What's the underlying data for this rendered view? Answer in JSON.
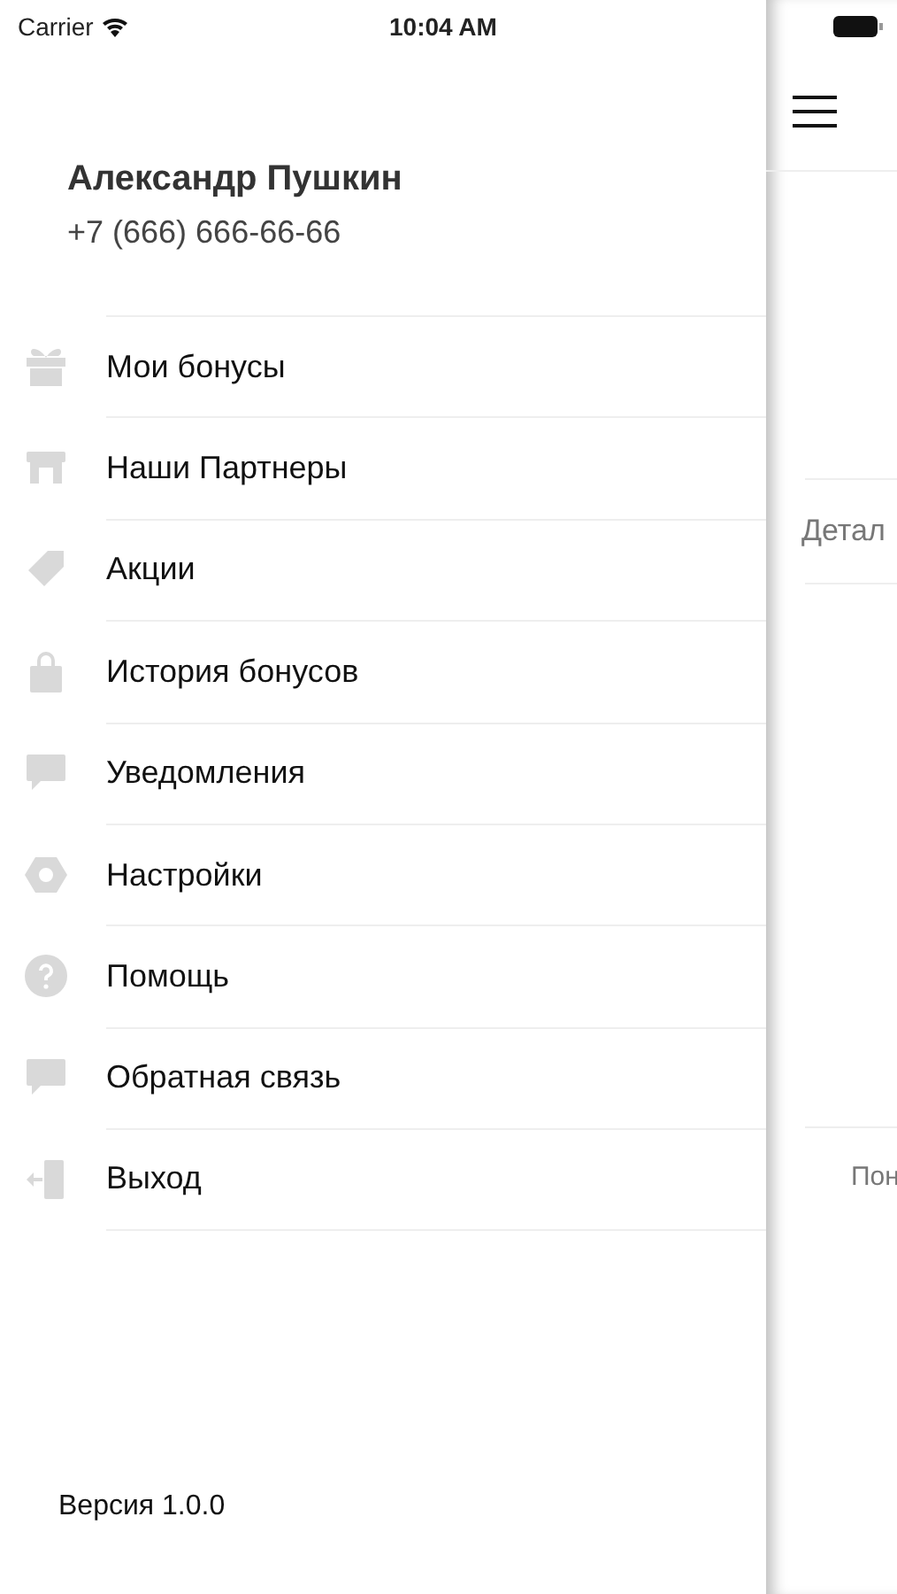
{
  "status_bar": {
    "carrier": "Carrier",
    "time": "10:04 AM"
  },
  "profile": {
    "name": "Александр Пушкин",
    "phone": "+7 (666) 666-66-66"
  },
  "menu": [
    {
      "label": "Мои бонусы",
      "kind": "gift"
    },
    {
      "label": "Наши Партнеры",
      "kind": "store"
    },
    {
      "label": "Акции",
      "kind": "tag"
    },
    {
      "label": "История бонусов",
      "kind": "bag"
    },
    {
      "label": "Уведомления",
      "kind": "chat"
    },
    {
      "label": "Настройки",
      "kind": "settings"
    },
    {
      "label": "Помощь",
      "kind": "help"
    },
    {
      "label": "Обратная связь",
      "kind": "chat"
    },
    {
      "label": "Выход",
      "kind": "logout"
    }
  ],
  "version": "Версия 1.0.0",
  "main_panel": {
    "row_1": "Детал",
    "row_2": "Пон"
  }
}
